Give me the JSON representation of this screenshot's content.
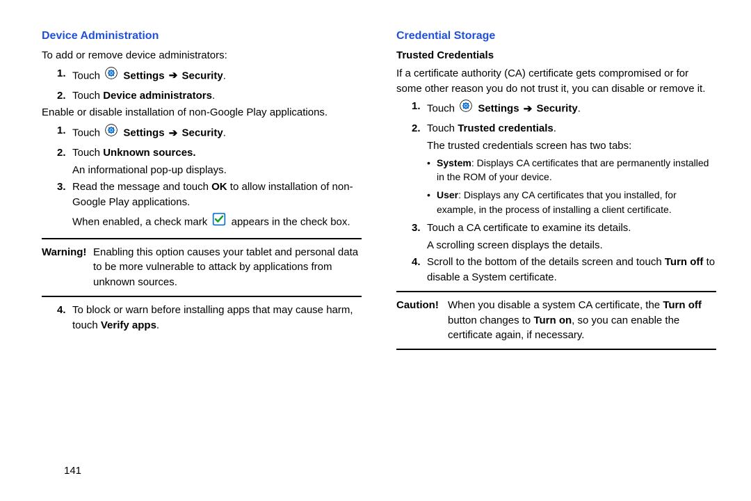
{
  "left": {
    "heading": "Device Administration",
    "p1": "To add or remove device administrators:",
    "s1_n": "1.",
    "s1_a": "Touch ",
    "s1_b": "Settings",
    "s1_c": "Security",
    "s2_n": "2.",
    "s2_a": "Touch ",
    "s2_b": "Device administrators",
    "p2": "Enable or disable installation of non-Google Play applications.",
    "s3_n": "1.",
    "s3_a": "Touch ",
    "s3_b": "Settings",
    "s3_c": "Security",
    "s4_n": "2.",
    "s4_a": "Touch ",
    "s4_b": "Unknown sources.",
    "s4_ind": "An informational pop-up displays.",
    "s5_n": "3.",
    "s5_a": "Read the message and touch ",
    "s5_b": "OK",
    "s5_c": " to allow installation of non-Google Play applications.",
    "s5_ind_a": "When enabled, a check mark ",
    "s5_ind_b": " appears in the check box.",
    "warn_label": "Warning!",
    "warn_body": "Enabling this option causes your tablet and personal data to be more vulnerable to attack by applications from unknown sources.",
    "s6_n": "4.",
    "s6_a": "To block or warn before installing apps that may cause harm, touch ",
    "s6_b": "Verify apps"
  },
  "right": {
    "heading": "Credential Storage",
    "sub": "Trusted Credentials",
    "p1": "If a certificate authority (CA) certificate gets compromised or for some other reason you do not trust it, you can disable or remove it.",
    "s1_n": "1.",
    "s1_a": "Touch ",
    "s1_b": "Settings",
    "s1_c": "Security",
    "s2_n": "2.",
    "s2_a": "Touch ",
    "s2_b": "Trusted credentials",
    "s2_ind": "The trusted credentials screen has two tabs:",
    "b1_a": "System",
    "b1_b": ": Displays CA certificates that are permanently installed in the ROM of your device.",
    "b2_a": "User",
    "b2_b": ": Displays any CA certificates that you installed, for example, in the process of installing a client certificate.",
    "s3_n": "3.",
    "s3_a": "Touch a CA certificate to examine its details.",
    "s3_ind": "A scrolling screen displays the details.",
    "s4_n": "4.",
    "s4_a": "Scroll to the bottom of the details screen and touch ",
    "s4_b": "Turn off",
    "s4_c": " to disable a System certificate.",
    "caution_label": "Caution!",
    "caution_a": "When you disable a system CA certificate, the ",
    "caution_b": "Turn off",
    "caution_c": " button changes to ",
    "caution_d": "Turn on",
    "caution_e": ", so you can enable the certificate again, if necessary."
  },
  "page_number": "141",
  "arrow": "➔",
  "bullet": "•",
  "period": "."
}
